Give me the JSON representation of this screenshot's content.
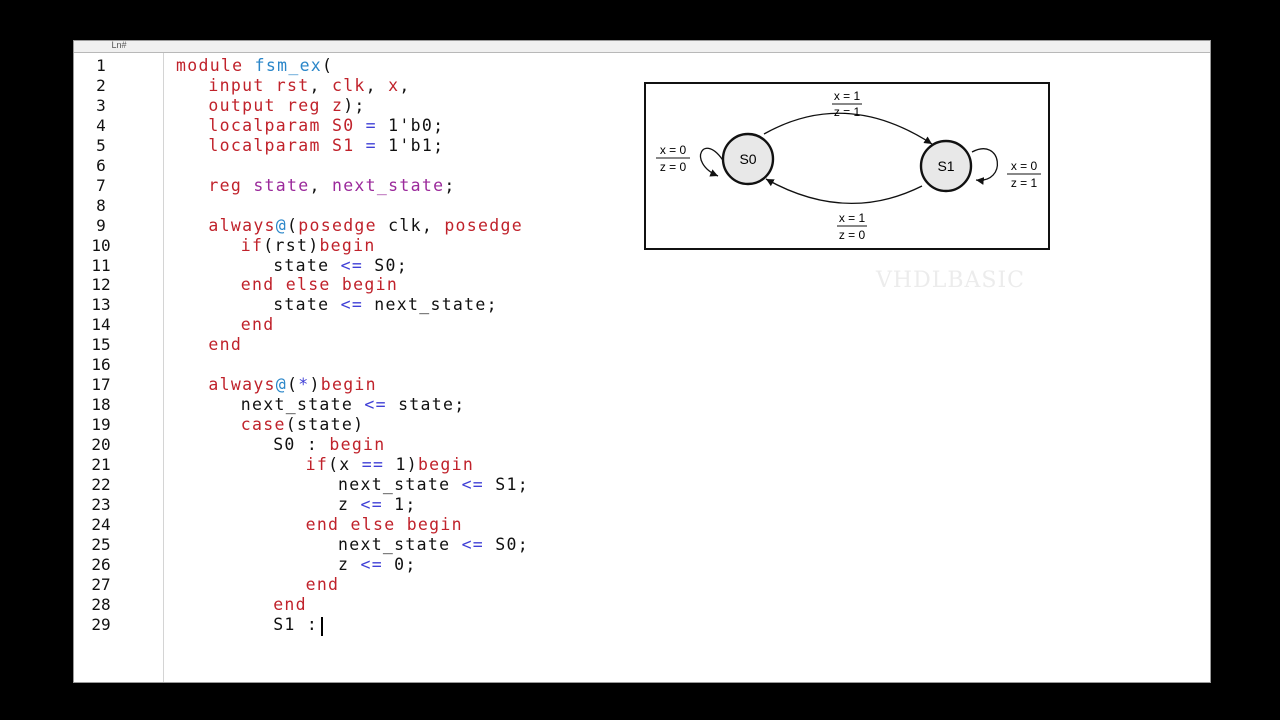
{
  "editor": {
    "gutter_header": "Ln#",
    "lines": [
      {
        "n": "1",
        "indent": 0,
        "tokens": [
          [
            "kw",
            "module"
          ],
          [
            "t",
            " "
          ],
          [
            "id",
            "fsm_ex"
          ],
          [
            "t",
            "("
          ]
        ]
      },
      {
        "n": "2",
        "indent": 2,
        "tokens": [
          [
            "kw",
            "input"
          ],
          [
            "t",
            " "
          ],
          [
            "kw",
            "rst"
          ],
          [
            "t",
            ", "
          ],
          [
            "kw",
            "clk"
          ],
          [
            "t",
            ", "
          ],
          [
            "kw",
            "x"
          ],
          [
            "t",
            ","
          ]
        ]
      },
      {
        "n": "3",
        "indent": 2,
        "tokens": [
          [
            "kw",
            "output"
          ],
          [
            "t",
            " "
          ],
          [
            "kw",
            "reg"
          ],
          [
            "t",
            " "
          ],
          [
            "kw",
            "z"
          ],
          [
            "t",
            ");"
          ]
        ]
      },
      {
        "n": "4",
        "indent": 2,
        "tokens": [
          [
            "kw",
            "localparam"
          ],
          [
            "t",
            " "
          ],
          [
            "kw",
            "S0"
          ],
          [
            "t",
            " "
          ],
          [
            "op",
            "="
          ],
          [
            "t",
            " 1'b0;"
          ]
        ]
      },
      {
        "n": "5",
        "indent": 2,
        "tokens": [
          [
            "kw",
            "localparam"
          ],
          [
            "t",
            " "
          ],
          [
            "kw",
            "S1"
          ],
          [
            "t",
            " "
          ],
          [
            "op",
            "="
          ],
          [
            "t",
            " 1'b1;"
          ]
        ]
      },
      {
        "n": "6",
        "indent": 0,
        "tokens": []
      },
      {
        "n": "7",
        "indent": 2,
        "tokens": [
          [
            "kw",
            "reg"
          ],
          [
            "t",
            " "
          ],
          [
            "pp",
            "state"
          ],
          [
            "t",
            ", "
          ],
          [
            "pp",
            "next_state"
          ],
          [
            "t",
            ";"
          ]
        ]
      },
      {
        "n": "8",
        "indent": 0,
        "tokens": []
      },
      {
        "n": "9",
        "indent": 2,
        "tokens": [
          [
            "kw",
            "always"
          ],
          [
            "at",
            "@"
          ],
          [
            "t",
            "("
          ],
          [
            "kw",
            "posedge"
          ],
          [
            "t",
            " clk, "
          ],
          [
            "kw",
            "posedge"
          ]
        ]
      },
      {
        "n": "10",
        "indent": 4,
        "tokens": [
          [
            "kw",
            "if"
          ],
          [
            "t",
            "(rst)"
          ],
          [
            "kw",
            "begin"
          ]
        ]
      },
      {
        "n": "11",
        "indent": 6,
        "tokens": [
          [
            "t",
            "state "
          ],
          [
            "op",
            "<="
          ],
          [
            "t",
            " S0;"
          ]
        ]
      },
      {
        "n": "12",
        "indent": 4,
        "tokens": [
          [
            "kw",
            "end"
          ],
          [
            "t",
            " "
          ],
          [
            "kw",
            "else"
          ],
          [
            "t",
            " "
          ],
          [
            "kw",
            "begin"
          ]
        ]
      },
      {
        "n": "13",
        "indent": 6,
        "tokens": [
          [
            "t",
            "state "
          ],
          [
            "op",
            "<="
          ],
          [
            "t",
            " next_state;"
          ]
        ]
      },
      {
        "n": "14",
        "indent": 4,
        "tokens": [
          [
            "kw",
            "end"
          ]
        ]
      },
      {
        "n": "15",
        "indent": 2,
        "tokens": [
          [
            "kw",
            "end"
          ]
        ]
      },
      {
        "n": "16",
        "indent": 0,
        "tokens": []
      },
      {
        "n": "17",
        "indent": 2,
        "tokens": [
          [
            "kw",
            "always"
          ],
          [
            "at",
            "@"
          ],
          [
            "t",
            "("
          ],
          [
            "op",
            "*"
          ],
          [
            "t",
            ")"
          ],
          [
            "kw",
            "begin"
          ]
        ]
      },
      {
        "n": "18",
        "indent": 4,
        "tokens": [
          [
            "t",
            "next_state "
          ],
          [
            "op",
            "<="
          ],
          [
            "t",
            " state;"
          ]
        ]
      },
      {
        "n": "19",
        "indent": 4,
        "tokens": [
          [
            "kw",
            "case"
          ],
          [
            "t",
            "(state)"
          ]
        ]
      },
      {
        "n": "20",
        "indent": 6,
        "tokens": [
          [
            "t",
            "S0 : "
          ],
          [
            "kw",
            "begin"
          ]
        ]
      },
      {
        "n": "21",
        "indent": 8,
        "tokens": [
          [
            "kw",
            "if"
          ],
          [
            "t",
            "(x "
          ],
          [
            "op",
            "=="
          ],
          [
            "t",
            " 1)"
          ],
          [
            "kw",
            "begin"
          ]
        ]
      },
      {
        "n": "22",
        "indent": 10,
        "tokens": [
          [
            "t",
            "next_state "
          ],
          [
            "op",
            "<="
          ],
          [
            "t",
            " S1;"
          ]
        ]
      },
      {
        "n": "23",
        "indent": 10,
        "tokens": [
          [
            "t",
            "z "
          ],
          [
            "op",
            "<="
          ],
          [
            "t",
            " 1;"
          ]
        ]
      },
      {
        "n": "24",
        "indent": 8,
        "tokens": [
          [
            "kw",
            "end"
          ],
          [
            "t",
            " "
          ],
          [
            "kw",
            "else"
          ],
          [
            "t",
            " "
          ],
          [
            "kw",
            "begin"
          ]
        ]
      },
      {
        "n": "25",
        "indent": 10,
        "tokens": [
          [
            "t",
            "next_state "
          ],
          [
            "op",
            "<="
          ],
          [
            "t",
            " S0;"
          ]
        ]
      },
      {
        "n": "26",
        "indent": 10,
        "tokens": [
          [
            "t",
            "z "
          ],
          [
            "op",
            "<="
          ],
          [
            "t",
            " 0;"
          ]
        ]
      },
      {
        "n": "27",
        "indent": 8,
        "tokens": [
          [
            "kw",
            "end"
          ]
        ]
      },
      {
        "n": "28",
        "indent": 6,
        "tokens": [
          [
            "kw",
            "end"
          ]
        ]
      },
      {
        "n": "29",
        "indent": 6,
        "tokens": [
          [
            "t",
            "S1 :"
          ]
        ]
      }
    ]
  },
  "diagram": {
    "state_s0": "S0",
    "state_s1": "S1",
    "top_x": "x = 1",
    "top_z": "z = 1",
    "bottom_x": "x = 1",
    "bottom_z": "z = 0",
    "left_x": "x = 0",
    "left_z": "z = 0",
    "right_x": "x = 0",
    "right_z": "z = 1"
  },
  "watermark": "VHDLBASIC",
  "colors": {
    "keyword": "#c0222b",
    "identifier": "#2a86c9",
    "register": "#9b2a9b",
    "operator": "#3f3fd6"
  }
}
